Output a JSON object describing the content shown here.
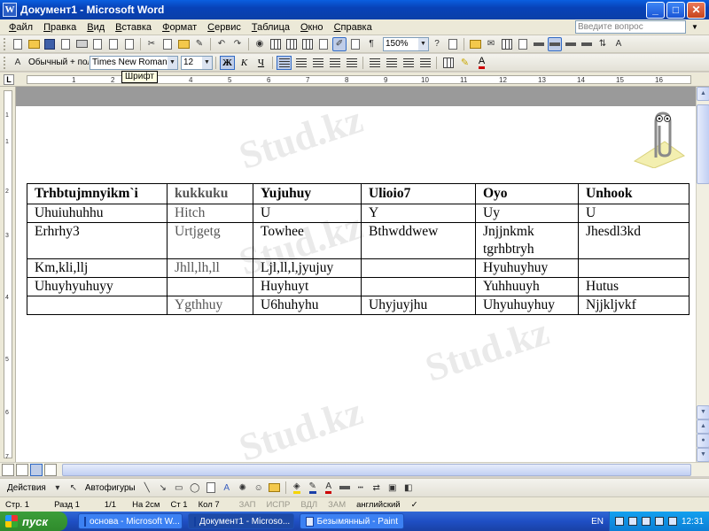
{
  "window": {
    "title": "Документ1 - Microsoft Word",
    "app_icon_letter": "W",
    "min_label": "_",
    "max_label": "□",
    "close_label": "✕"
  },
  "menu": {
    "items": [
      "Файл",
      "Правка",
      "Вид",
      "Вставка",
      "Формат",
      "Сервис",
      "Таблица",
      "Окно",
      "Справка"
    ],
    "help_placeholder": "Введите вопрос"
  },
  "standard_toolbar": {
    "zoom": "150%",
    "paragraph_mark": "¶"
  },
  "format_toolbar": {
    "style": "Обычный + пол",
    "font": "Times New Roman",
    "size": "12",
    "bold": "Ж",
    "italic": "К",
    "underline": "Ч"
  },
  "tooltip": "Шрифт",
  "ruler": {
    "corner": "L",
    "numbers": [
      "1",
      "2",
      "3",
      "4",
      "5",
      "6",
      "7",
      "8",
      "9",
      "10",
      "11",
      "12",
      "13",
      "14",
      "15",
      "16"
    ]
  },
  "vruler": {
    "numbers": [
      "1",
      "1",
      "2",
      "3",
      "4",
      "5",
      "6",
      "7"
    ]
  },
  "watermark": "Stud.kz",
  "table": {
    "rows": [
      [
        "Trhbtujmnyikm`i",
        "kukkuku",
        "Yujuhuy",
        "Ulioio7",
        "Oyo",
        "Unhook"
      ],
      [
        "Uhuiuhuhhu",
        "Hitch",
        "U",
        "Y",
        "Uy",
        "U"
      ],
      [
        "Erhrhy3",
        "Urtjgetg",
        "Towhee",
        "Bthwddwew",
        "Jnjjnkmk tgrhbtryh",
        "Jhesdl3kd"
      ],
      [
        "Km,kli,llj",
        "Jhll,lh,ll",
        "Ljl,ll,l,jyujuy",
        "",
        "Hyuhuyhuy",
        ""
      ],
      [
        "Uhuyhyuhuyy",
        "",
        "Huyhuyt",
        "",
        "Yuhhuuyh",
        "Hutus"
      ],
      [
        "",
        "Ygthhuy",
        "U6huhyhu",
        "Uhyjuyjhu",
        "Uhyuhuyhuy",
        "Njjkljvkf"
      ]
    ]
  },
  "drawing_toolbar": {
    "actions": "Действия",
    "autoshapes": "Автофигуры"
  },
  "status": {
    "page": "Стр. 1",
    "section": "Разд 1",
    "pages": "1/1",
    "at": "На 2см",
    "line": "Ст 1",
    "col": "Кол 7",
    "rec": "ЗАП",
    "trk": "ИСПР",
    "ext": "ВДЛ",
    "ovr": "ЗАМ",
    "language": "английский"
  },
  "taskbar": {
    "start": "пуск",
    "tasks": [
      "основа - Microsoft W...",
      "Документ1 - Microso...",
      "Безымянный - Paint"
    ],
    "lang": "EN",
    "clock": "12:31"
  },
  "colors": {
    "titlebar": "#0842b8",
    "taskbar": "#1f4fc4",
    "start": "#2f8b2c"
  }
}
